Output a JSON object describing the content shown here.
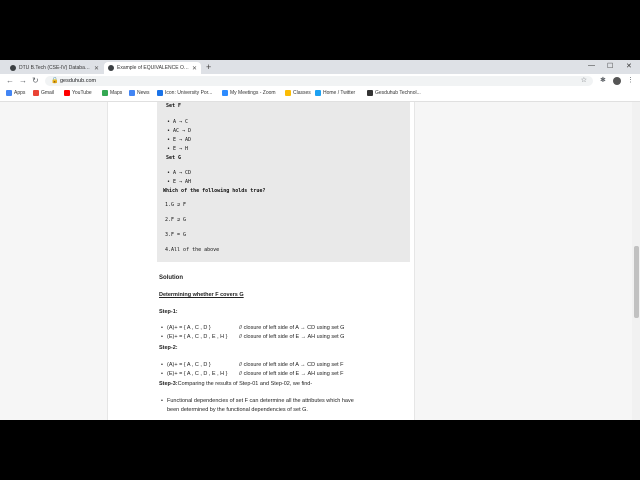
{
  "browser": {
    "tabs": [
      {
        "label": "DTU B.Tech (CSE-IV) Database M..."
      },
      {
        "label": "Example of EQUIVALENCE OF F..."
      }
    ],
    "new_tab": "+",
    "window_controls": {
      "minimize": "—",
      "maximize": "☐",
      "close": "✕"
    },
    "url": "gesduhub.com",
    "bookmarks": [
      {
        "label": "Apps",
        "color": "#4285f4"
      },
      {
        "label": "Gmail",
        "color": "#ea4335"
      },
      {
        "label": "YouTube",
        "color": "#ff0000"
      },
      {
        "label": "Maps",
        "color": "#34a853"
      },
      {
        "label": "News",
        "color": "#4285f4"
      },
      {
        "label": "Icon: University Por...",
        "color": "#1a73e8"
      },
      {
        "label": "My Meetings - Zoom",
        "color": "#2d8cff"
      },
      {
        "label": "Classes",
        "color": "#fbbc04"
      },
      {
        "label": "Home / Twitter",
        "color": "#1da1f2"
      },
      {
        "label": "Gesduhub Technol...",
        "color": "#333333"
      }
    ]
  },
  "question": {
    "set_f_label": "Set F",
    "set_f_items": [
      "A → C",
      "AC → D",
      "E → AD",
      "E → H"
    ],
    "set_g_label": "Set G",
    "set_g_items": [
      "A → CD",
      "E → AH"
    ],
    "prompt": "Which of the following holds true?",
    "options": [
      "1.G ⊇ F",
      "2.F ⊇ G",
      "3.F = G",
      "4.All of the above"
    ]
  },
  "solution": {
    "heading": "Solution",
    "subheading": "Determining whether F covers G",
    "step1_label": "Step-1:",
    "step1_items": [
      {
        "closure": "(A)+ = { A , C , D }",
        "comment": "// closure of left side of A → CD using set G"
      },
      {
        "closure": "(E)+ = { A , C , D , E , H }",
        "comment": "// closure of left side of E → AH using set G"
      }
    ],
    "step2_label": "Step-2:",
    "step2_items": [
      {
        "closure": "(A)+ = { A , C , D }",
        "comment": "// closure of left side of A → CD using set F"
      },
      {
        "closure": "(E)+ = { A , C , D , E , H }",
        "comment": "// closure of left side of E → AH using set F"
      }
    ],
    "step3_label": "Step-3:",
    "step3_text": "Comparing the results of Step-01 and Step-02, we find-",
    "conclusion_line1": "Functional dependencies of set F can determine all the attributes which have",
    "conclusion_line2": "been determined by the functional dependencies of set G."
  }
}
